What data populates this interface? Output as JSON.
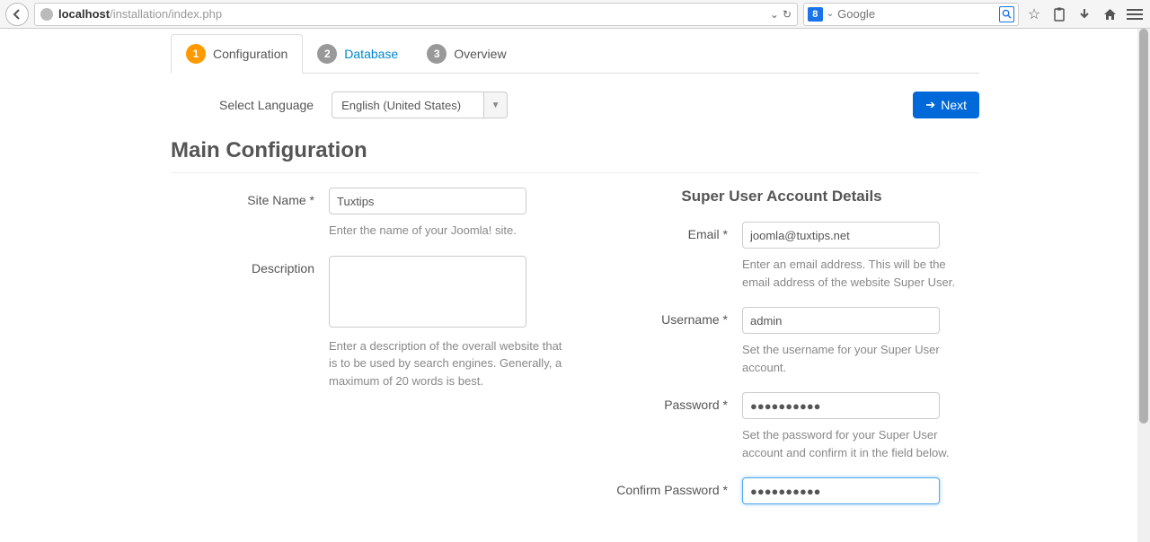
{
  "browser": {
    "url_host": "localhost",
    "url_path": "/installation/index.php",
    "search_placeholder": "Google",
    "dropdown_glyph": "⌄",
    "reload_glyph": "↻"
  },
  "tabs": {
    "step1_num": "1",
    "step1_label": "Configuration",
    "step2_num": "2",
    "step2_label": "Database",
    "step3_num": "3",
    "step3_label": "Overview"
  },
  "language": {
    "label": "Select Language",
    "value": "English (United States)"
  },
  "next_button": "Next",
  "heading": "Main Configuration",
  "left": {
    "site_name_label": "Site Name *",
    "site_name_value": "Tuxtips",
    "site_name_help": "Enter the name of your Joomla! site.",
    "description_label": "Description",
    "description_value": "",
    "description_help": "Enter a description of the overall website that is to be used by search engines. Generally, a maximum of 20 words is best."
  },
  "right": {
    "subheading": "Super User Account Details",
    "email_label": "Email *",
    "email_value": "joomla@tuxtips.net",
    "email_help": "Enter an email address. This will be the email address of the website Super User.",
    "username_label": "Username *",
    "username_value": "admin",
    "username_help": "Set the username for your Super User account.",
    "password_label": "Password *",
    "password_value": "●●●●●●●●●●",
    "password_help": "Set the password for your Super User account and confirm it in the field below.",
    "confirm_label": "Confirm Password *",
    "confirm_value": "●●●●●●●●●●"
  }
}
